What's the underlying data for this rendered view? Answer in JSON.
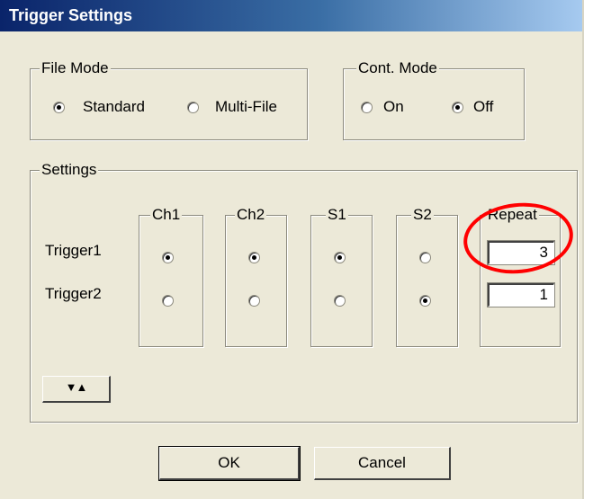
{
  "window": {
    "title": "Trigger Settings"
  },
  "file_mode": {
    "label": "File Mode",
    "options": [
      {
        "label": "Standard",
        "checked": true
      },
      {
        "label": "Multi-File",
        "checked": false
      }
    ]
  },
  "cont_mode": {
    "label": "Cont. Mode",
    "options": [
      {
        "label": "On",
        "checked": false
      },
      {
        "label": "Off",
        "checked": true
      }
    ]
  },
  "settings": {
    "label": "Settings",
    "columns": [
      "Ch1",
      "Ch2",
      "S1",
      "S2"
    ],
    "repeat_label": "Repeat",
    "rows": [
      {
        "label": "Trigger1",
        "selected": [
          true,
          true,
          true,
          false
        ],
        "repeat": "3"
      },
      {
        "label": "Trigger2",
        "selected": [
          false,
          false,
          false,
          true
        ],
        "repeat": "1"
      }
    ],
    "toggle_glyph": "▼▲"
  },
  "buttons": {
    "ok": "OK",
    "cancel": "Cancel"
  },
  "annotation": {
    "color": "#ff0000",
    "shape": "circle around Repeat column"
  }
}
